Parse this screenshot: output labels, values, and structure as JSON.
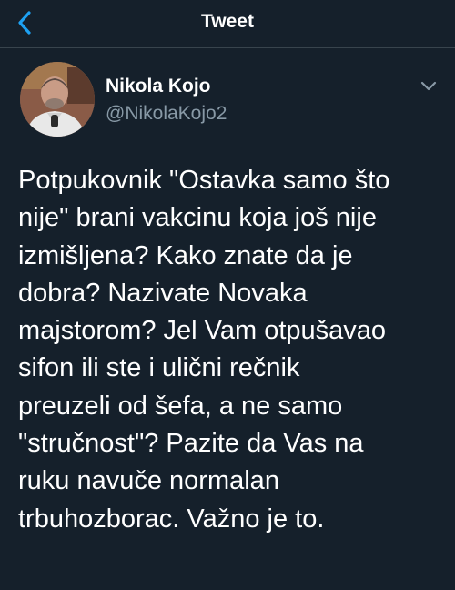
{
  "header": {
    "title": "Tweet",
    "back_icon": "chevron-left-icon",
    "accent_color": "#1da1f2"
  },
  "author": {
    "display_name": "Nikola Kojo",
    "handle": "@NikolaKojo2",
    "menu_icon": "chevron-down-icon"
  },
  "tweet": {
    "text": "Potpukovnik \"Ostavka samo što\nnije\" brani vakcinu koja još nije\nizmišljena? Kako znate da je\ndobra? Nazivate Novaka\nmajstorom? Jel Vam otpušavao\nsifon ili ste i ulični rečnik\npreuzeli od šefa, a ne samo\n\"stručnost\"? Pazite da Vas na\nruku navuče normalan\ntrbuhozborac. Važno je to."
  },
  "colors": {
    "background": "#15202b",
    "divider": "#38444d",
    "secondary_text": "#8899a6"
  }
}
